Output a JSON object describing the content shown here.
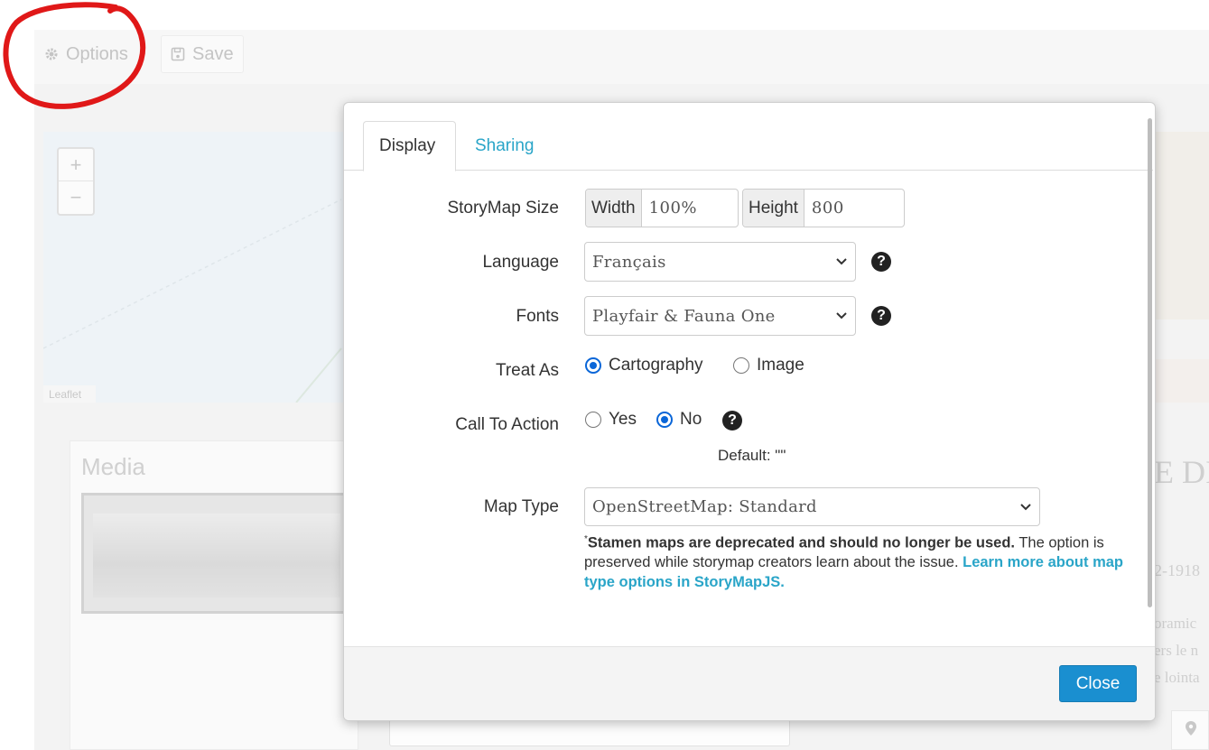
{
  "toolbar": {
    "options_label": "Options",
    "save_label": "Save"
  },
  "background": {
    "zoom_in": "+",
    "zoom_out": "−",
    "leaflet_label": "Leaflet",
    "media_title": "Media",
    "right_text_heading": "E DI",
    "right_text_date": "2-1918",
    "right_text_line1": "oramic",
    "right_text_line2": "ers le n",
    "right_text_line3": "e lointa"
  },
  "modal": {
    "tabs": [
      {
        "label": "Display",
        "active": true
      },
      {
        "label": "Sharing",
        "active": false
      }
    ],
    "storymap_size": {
      "label": "StoryMap Size",
      "width_addon": "Width",
      "width_value": "100%",
      "height_addon": "Height",
      "height_value": "800"
    },
    "language": {
      "label": "Language",
      "selected": "Français"
    },
    "fonts": {
      "label": "Fonts",
      "selected": "Playfair & Fauna One"
    },
    "treat_as": {
      "label": "Treat As",
      "options": [
        {
          "label": "Cartography",
          "checked": true
        },
        {
          "label": "Image",
          "checked": false
        }
      ]
    },
    "call_to_action": {
      "label": "Call To Action",
      "options": [
        {
          "label": "Yes",
          "checked": false
        },
        {
          "label": "No",
          "checked": true
        }
      ],
      "default_text": "Default: \"\""
    },
    "map_type": {
      "label": "Map Type",
      "selected": "OpenStreetMap: Standard",
      "note_star": "*",
      "note_bold": "Stamen maps are deprecated and should no longer be used.",
      "note_text": " The option is preserved while storymap creators learn about the issue. ",
      "note_link": "Learn more about map type options in StoryMapJS."
    },
    "help_glyph": "?",
    "close_label": "Close"
  },
  "colors": {
    "accent_link": "#2aa5c8",
    "primary_button": "#1a8fd0",
    "radio_checked": "#0a66d8",
    "annotation_red": "#e01818"
  }
}
